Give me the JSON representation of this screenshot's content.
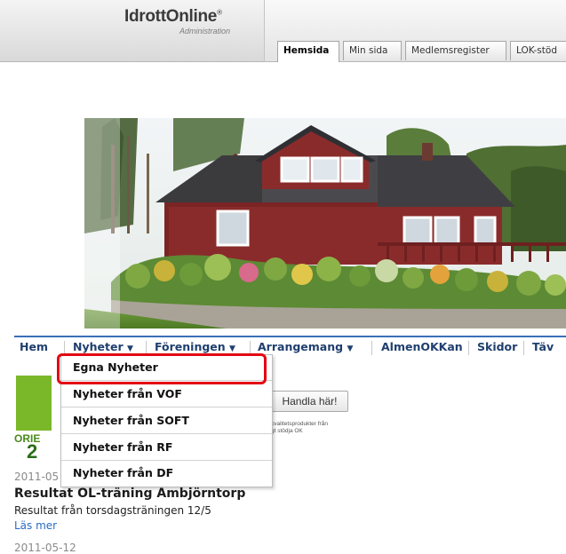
{
  "header": {
    "logo_text": "IdrottOnline",
    "logo_mark": "®",
    "logo_subtitle": "Administration",
    "tabs": [
      {
        "label": "Hemsida",
        "active": true
      },
      {
        "label": "Min sida",
        "active": false
      },
      {
        "label": "Medlemsregister",
        "active": false
      },
      {
        "label": "LOK-stöd",
        "active": false
      }
    ]
  },
  "nav": {
    "items": [
      {
        "label": "Hem",
        "has_caret": false
      },
      {
        "label": "Nyheter",
        "has_caret": true
      },
      {
        "label": "Föreningen",
        "has_caret": true
      },
      {
        "label": "Arrangemang",
        "has_caret": true
      },
      {
        "label": "AlmenOKKan",
        "has_caret": false
      },
      {
        "label": "Skidor",
        "has_caret": false
      },
      {
        "label": "Täv",
        "has_caret": false
      }
    ],
    "caret_glyph": "▼",
    "accent_color": "#3b6fb8"
  },
  "dropdown": {
    "items": [
      {
        "label": "Egna Nyheter",
        "highlighted": true
      },
      {
        "label": "Nyheter från VOF",
        "highlighted": false
      },
      {
        "label": "Nyheter från SOFT",
        "highlighted": false
      },
      {
        "label": "Nyheter från RF",
        "highlighted": false
      },
      {
        "label": "Nyheter från DF",
        "highlighted": false
      }
    ],
    "highlight_color": "#e30613"
  },
  "promo": {
    "logo_ori": "ORIE",
    "logo_num": "2",
    "button_label": "Handla här!",
    "small_text": "kvalitetsprodukter från\ngt stödja OK"
  },
  "news": [
    {
      "date": "2011-05",
      "title": "Resultat OL-träning Ambjörntorp",
      "excerpt": "Resultat från torsdagsträningen 12/5",
      "more": "Läs mer"
    },
    {
      "date": "2011-05-12"
    }
  ]
}
